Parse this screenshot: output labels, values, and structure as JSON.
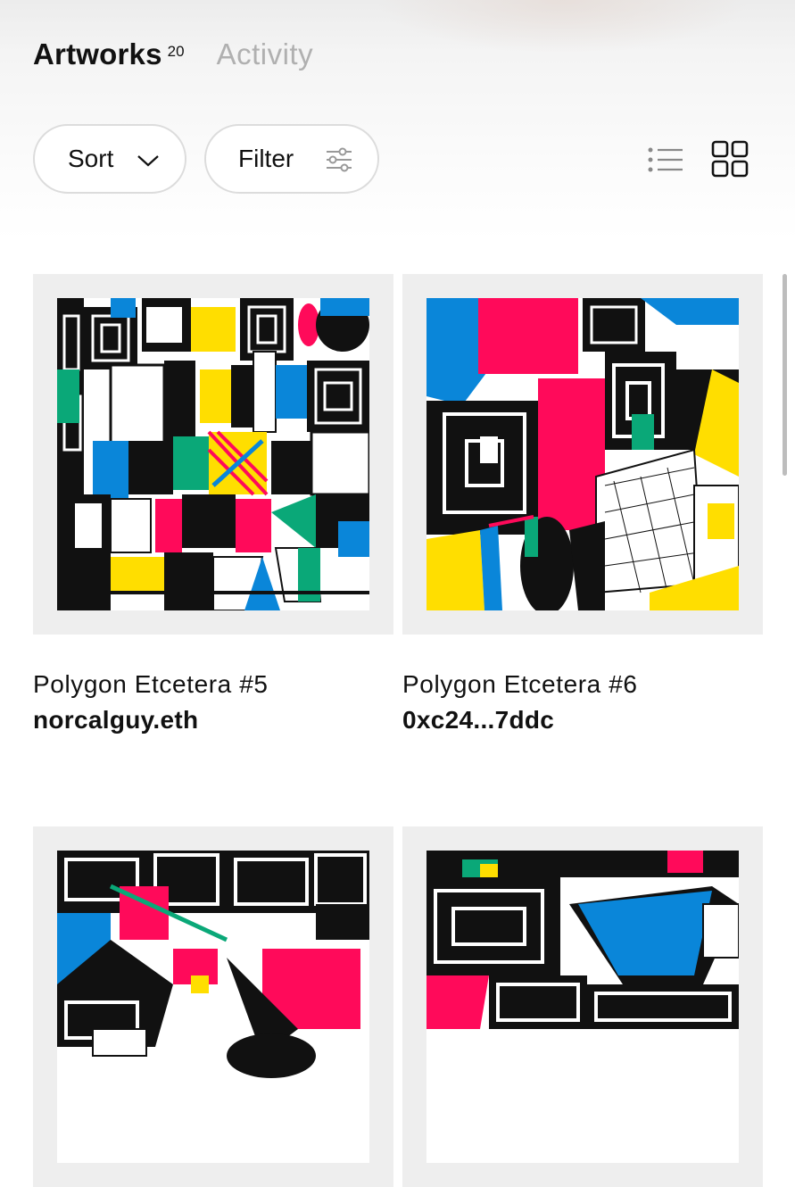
{
  "tabs": {
    "artworks_label": "Artworks",
    "artworks_count": "20",
    "activity_label": "Activity"
  },
  "toolbar": {
    "sort_label": "Sort",
    "filter_label": "Filter",
    "list_view_icon": "list-icon",
    "grid_view_icon": "grid-icon"
  },
  "artworks": [
    {
      "title": "Polygon Etcetera #5",
      "owner": "norcalguy.eth"
    },
    {
      "title": "Polygon Etcetera #6",
      "owner": "0xc24...7ddc"
    },
    {
      "title": "",
      "owner": ""
    },
    {
      "title": "",
      "owner": ""
    }
  ],
  "colors": {
    "blue": "#0a86d9",
    "pink": "#ff0a5a",
    "yellow": "#ffde00",
    "green": "#0aa878",
    "black": "#111111"
  }
}
